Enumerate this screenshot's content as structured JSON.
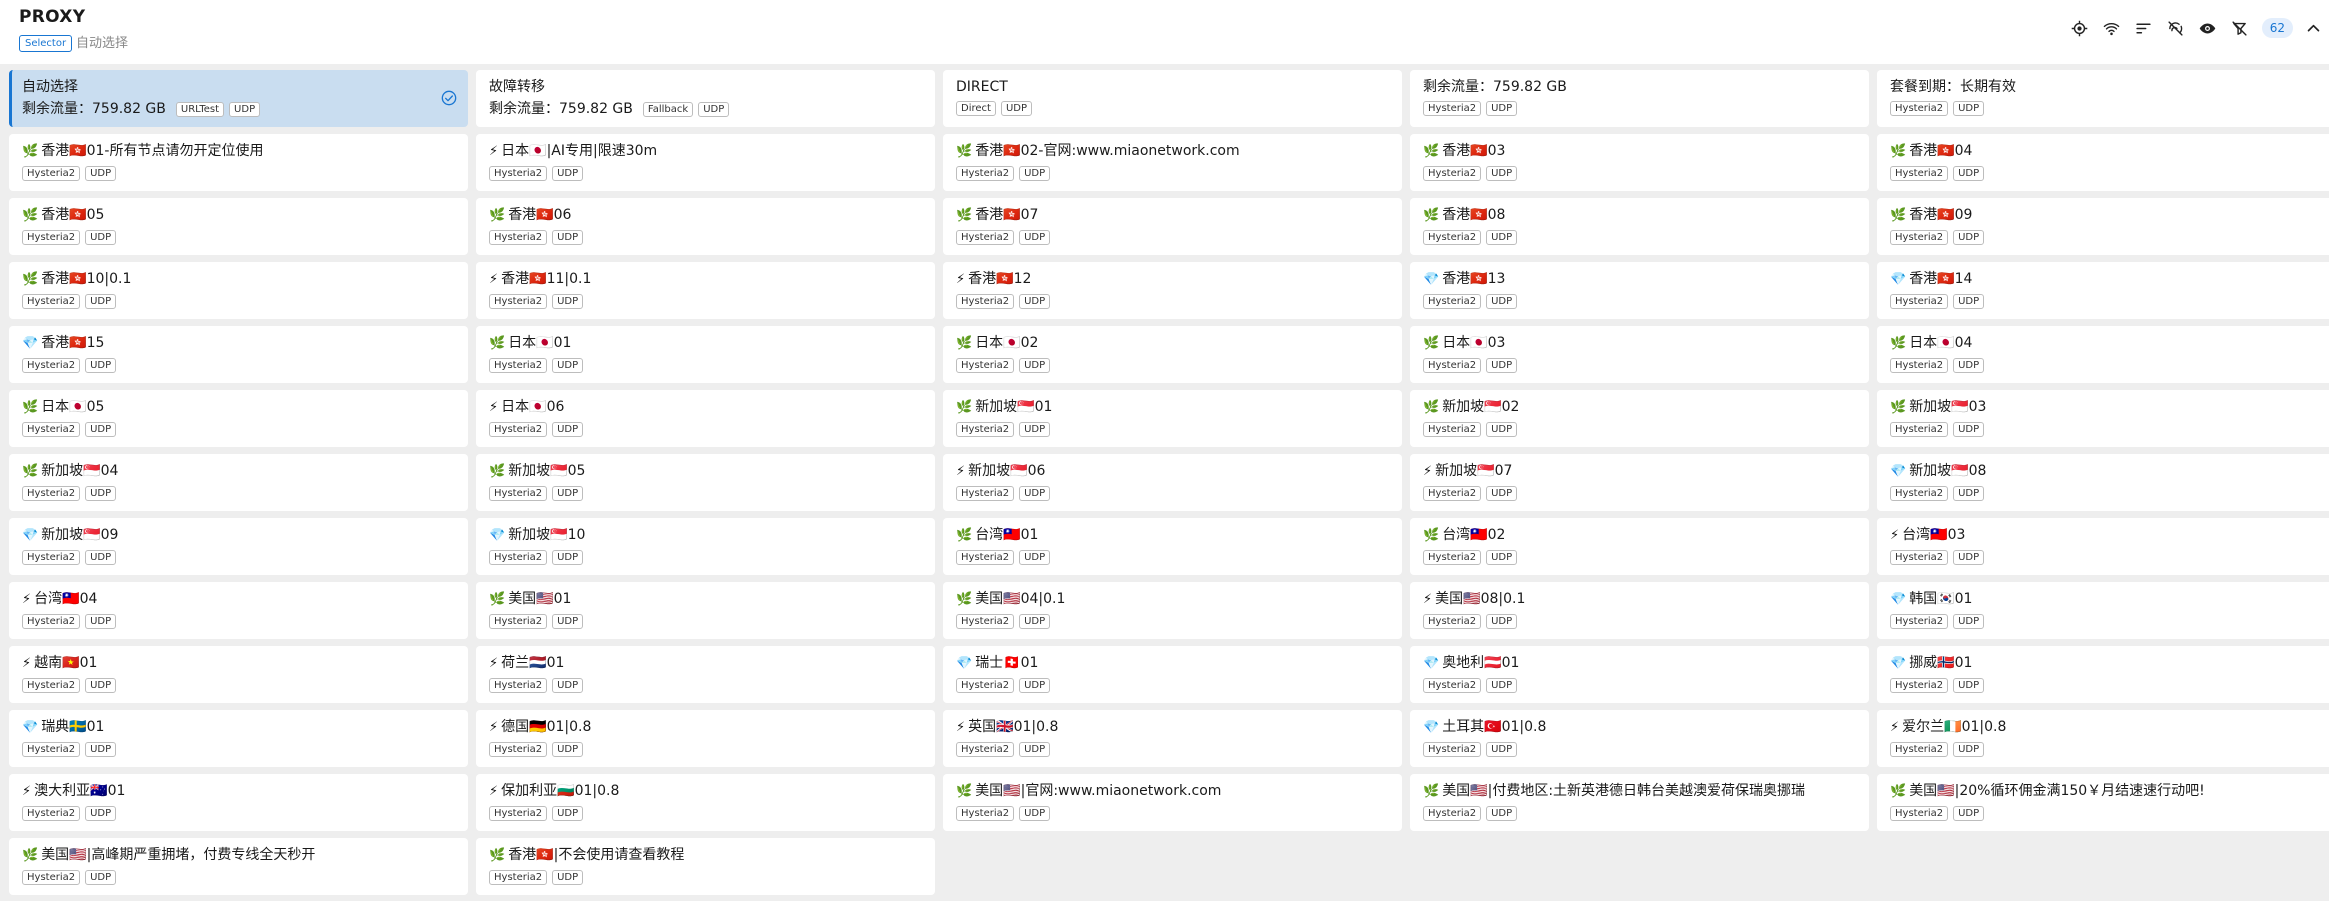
{
  "header": {
    "title": "PROXY",
    "type": "Selector",
    "now": "自动选择",
    "icons": [
      "locate-icon",
      "wifi-icon",
      "sort-icon",
      "signal-off-icon",
      "eye-icon",
      "filter-off-icon"
    ],
    "count": "62"
  },
  "colors": {
    "accent": "#1976d2",
    "selected_bg": "#c9ddf0",
    "flame": "#e8a317",
    "gem": "#42a5f5",
    "leaf": "#6b9a3c"
  },
  "proxies": [
    {
      "name": "自动选择",
      "sub": "剩余流量：759.82 GB",
      "tags": [
        "URLTest",
        "UDP"
      ],
      "icon": "",
      "selected": true
    },
    {
      "name": "故障转移",
      "sub": "剩余流量：759.82 GB",
      "tags": [
        "Fallback",
        "UDP"
      ],
      "icon": ""
    },
    {
      "name": "DIRECT",
      "sub": "",
      "tags": [
        "Direct",
        "UDP"
      ],
      "icon": ""
    },
    {
      "name": "剩余流量：759.82 GB",
      "sub": "",
      "tags": [
        "Hysteria2",
        "UDP"
      ],
      "icon": ""
    },
    {
      "name": "套餐到期：长期有效",
      "sub": "",
      "tags": [
        "Hysteria2",
        "UDP"
      ],
      "icon": ""
    },
    {
      "name": "香港🇭🇰01-所有节点请勿开定位使用",
      "sub": "",
      "tags": [
        "Hysteria2",
        "UDP"
      ],
      "icon": "leaf"
    },
    {
      "name": "日本🇯🇵|AI专用|限速30m",
      "sub": "",
      "tags": [
        "Hysteria2",
        "UDP"
      ],
      "icon": "bolt"
    },
    {
      "name": "香港🇭🇰02-官网:www.miaonetwork.com",
      "sub": "",
      "tags": [
        "Hysteria2",
        "UDP"
      ],
      "icon": "leaf"
    },
    {
      "name": "香港🇭🇰03",
      "sub": "",
      "tags": [
        "Hysteria2",
        "UDP"
      ],
      "icon": "leaf"
    },
    {
      "name": "香港🇭🇰04",
      "sub": "",
      "tags": [
        "Hysteria2",
        "UDP"
      ],
      "icon": "leaf"
    },
    {
      "name": "香港🇭🇰05",
      "sub": "",
      "tags": [
        "Hysteria2",
        "UDP"
      ],
      "icon": "leaf"
    },
    {
      "name": "香港🇭🇰06",
      "sub": "",
      "tags": [
        "Hysteria2",
        "UDP"
      ],
      "icon": "leaf"
    },
    {
      "name": "香港🇭🇰07",
      "sub": "",
      "tags": [
        "Hysteria2",
        "UDP"
      ],
      "icon": "leaf"
    },
    {
      "name": "香港🇭🇰08",
      "sub": "",
      "tags": [
        "Hysteria2",
        "UDP"
      ],
      "icon": "leaf"
    },
    {
      "name": "香港🇭🇰09",
      "sub": "",
      "tags": [
        "Hysteria2",
        "UDP"
      ],
      "icon": "leaf"
    },
    {
      "name": "香港🇭🇰10|0.1",
      "sub": "",
      "tags": [
        "Hysteria2",
        "UDP"
      ],
      "icon": "leaf"
    },
    {
      "name": "香港🇭🇰11|0.1",
      "sub": "",
      "tags": [
        "Hysteria2",
        "UDP"
      ],
      "icon": "bolt"
    },
    {
      "name": "香港🇭🇰12",
      "sub": "",
      "tags": [
        "Hysteria2",
        "UDP"
      ],
      "icon": "bolt"
    },
    {
      "name": "香港🇭🇰13",
      "sub": "",
      "tags": [
        "Hysteria2",
        "UDP"
      ],
      "icon": "gem"
    },
    {
      "name": "香港🇭🇰14",
      "sub": "",
      "tags": [
        "Hysteria2",
        "UDP"
      ],
      "icon": "gem"
    },
    {
      "name": "香港🇭🇰15",
      "sub": "",
      "tags": [
        "Hysteria2",
        "UDP"
      ],
      "icon": "gem"
    },
    {
      "name": "日本🇯🇵01",
      "sub": "",
      "tags": [
        "Hysteria2",
        "UDP"
      ],
      "icon": "leaf"
    },
    {
      "name": "日本🇯🇵02",
      "sub": "",
      "tags": [
        "Hysteria2",
        "UDP"
      ],
      "icon": "leaf"
    },
    {
      "name": "日本🇯🇵03",
      "sub": "",
      "tags": [
        "Hysteria2",
        "UDP"
      ],
      "icon": "leaf"
    },
    {
      "name": "日本🇯🇵04",
      "sub": "",
      "tags": [
        "Hysteria2",
        "UDP"
      ],
      "icon": "leaf"
    },
    {
      "name": "日本🇯🇵05",
      "sub": "",
      "tags": [
        "Hysteria2",
        "UDP"
      ],
      "icon": "leaf"
    },
    {
      "name": "日本🇯🇵06",
      "sub": "",
      "tags": [
        "Hysteria2",
        "UDP"
      ],
      "icon": "bolt"
    },
    {
      "name": "新加坡🇸🇬01",
      "sub": "",
      "tags": [
        "Hysteria2",
        "UDP"
      ],
      "icon": "leaf"
    },
    {
      "name": "新加坡🇸🇬02",
      "sub": "",
      "tags": [
        "Hysteria2",
        "UDP"
      ],
      "icon": "leaf"
    },
    {
      "name": "新加坡🇸🇬03",
      "sub": "",
      "tags": [
        "Hysteria2",
        "UDP"
      ],
      "icon": "leaf"
    },
    {
      "name": "新加坡🇸🇬04",
      "sub": "",
      "tags": [
        "Hysteria2",
        "UDP"
      ],
      "icon": "leaf"
    },
    {
      "name": "新加坡🇸🇬05",
      "sub": "",
      "tags": [
        "Hysteria2",
        "UDP"
      ],
      "icon": "leaf"
    },
    {
      "name": "新加坡🇸🇬06",
      "sub": "",
      "tags": [
        "Hysteria2",
        "UDP"
      ],
      "icon": "bolt"
    },
    {
      "name": "新加坡🇸🇬07",
      "sub": "",
      "tags": [
        "Hysteria2",
        "UDP"
      ],
      "icon": "bolt"
    },
    {
      "name": "新加坡🇸🇬08",
      "sub": "",
      "tags": [
        "Hysteria2",
        "UDP"
      ],
      "icon": "gem"
    },
    {
      "name": "新加坡🇸🇬09",
      "sub": "",
      "tags": [
        "Hysteria2",
        "UDP"
      ],
      "icon": "gem"
    },
    {
      "name": "新加坡🇸🇬10",
      "sub": "",
      "tags": [
        "Hysteria2",
        "UDP"
      ],
      "icon": "gem"
    },
    {
      "name": "台湾🇹🇼01",
      "sub": "",
      "tags": [
        "Hysteria2",
        "UDP"
      ],
      "icon": "leaf"
    },
    {
      "name": "台湾🇹🇼02",
      "sub": "",
      "tags": [
        "Hysteria2",
        "UDP"
      ],
      "icon": "leaf"
    },
    {
      "name": "台湾🇹🇼03",
      "sub": "",
      "tags": [
        "Hysteria2",
        "UDP"
      ],
      "icon": "bolt"
    },
    {
      "name": "台湾🇹🇼04",
      "sub": "",
      "tags": [
        "Hysteria2",
        "UDP"
      ],
      "icon": "bolt"
    },
    {
      "name": "美国🇺🇸01",
      "sub": "",
      "tags": [
        "Hysteria2",
        "UDP"
      ],
      "icon": "leaf"
    },
    {
      "name": "美国🇺🇸04|0.1",
      "sub": "",
      "tags": [
        "Hysteria2",
        "UDP"
      ],
      "icon": "leaf"
    },
    {
      "name": "美国🇺🇸08|0.1",
      "sub": "",
      "tags": [
        "Hysteria2",
        "UDP"
      ],
      "icon": "bolt"
    },
    {
      "name": "韩国🇰🇷01",
      "sub": "",
      "tags": [
        "Hysteria2",
        "UDP"
      ],
      "icon": "gem"
    },
    {
      "name": "越南🇻🇳01",
      "sub": "",
      "tags": [
        "Hysteria2",
        "UDP"
      ],
      "icon": "bolt"
    },
    {
      "name": "荷兰🇳🇱01",
      "sub": "",
      "tags": [
        "Hysteria2",
        "UDP"
      ],
      "icon": "bolt"
    },
    {
      "name": "瑞士🇨🇭01",
      "sub": "",
      "tags": [
        "Hysteria2",
        "UDP"
      ],
      "icon": "gem"
    },
    {
      "name": "奥地利🇦🇹01",
      "sub": "",
      "tags": [
        "Hysteria2",
        "UDP"
      ],
      "icon": "gem"
    },
    {
      "name": "挪威🇳🇴01",
      "sub": "",
      "tags": [
        "Hysteria2",
        "UDP"
      ],
      "icon": "gem"
    },
    {
      "name": "瑞典🇸🇪01",
      "sub": "",
      "tags": [
        "Hysteria2",
        "UDP"
      ],
      "icon": "gem"
    },
    {
      "name": "德国🇩🇪01|0.8",
      "sub": "",
      "tags": [
        "Hysteria2",
        "UDP"
      ],
      "icon": "bolt"
    },
    {
      "name": "英国🇬🇧01|0.8",
      "sub": "",
      "tags": [
        "Hysteria2",
        "UDP"
      ],
      "icon": "bolt"
    },
    {
      "name": "土耳其🇹🇷01|0.8",
      "sub": "",
      "tags": [
        "Hysteria2",
        "UDP"
      ],
      "icon": "gem"
    },
    {
      "name": "爱尔兰🇮🇪01|0.8",
      "sub": "",
      "tags": [
        "Hysteria2",
        "UDP"
      ],
      "icon": "bolt"
    },
    {
      "name": "澳大利亚🇦🇺01",
      "sub": "",
      "tags": [
        "Hysteria2",
        "UDP"
      ],
      "icon": "bolt"
    },
    {
      "name": "保加利亚🇧🇬01|0.8",
      "sub": "",
      "tags": [
        "Hysteria2",
        "UDP"
      ],
      "icon": "bolt"
    },
    {
      "name": "美国🇺🇸|官网:www.miaonetwork.com",
      "sub": "",
      "tags": [
        "Hysteria2",
        "UDP"
      ],
      "icon": "leaf"
    },
    {
      "name": "美国🇺🇸|付费地区:土新英港德日韩台美越澳爱荷保瑞奥挪瑞",
      "sub": "",
      "tags": [
        "Hysteria2",
        "UDP"
      ],
      "icon": "leaf"
    },
    {
      "name": "美国🇺🇸|20%循环佣金满150￥月结速速行动吧!",
      "sub": "",
      "tags": [
        "Hysteria2",
        "UDP"
      ],
      "icon": "leaf"
    },
    {
      "name": "美国🇺🇸|高峰期严重拥堵，付费专线全天秒开",
      "sub": "",
      "tags": [
        "Hysteria2",
        "UDP"
      ],
      "icon": "leaf"
    },
    {
      "name": "香港🇭🇰|不会使用请查看教程",
      "sub": "",
      "tags": [
        "Hysteria2",
        "UDP"
      ],
      "icon": "leaf"
    }
  ]
}
